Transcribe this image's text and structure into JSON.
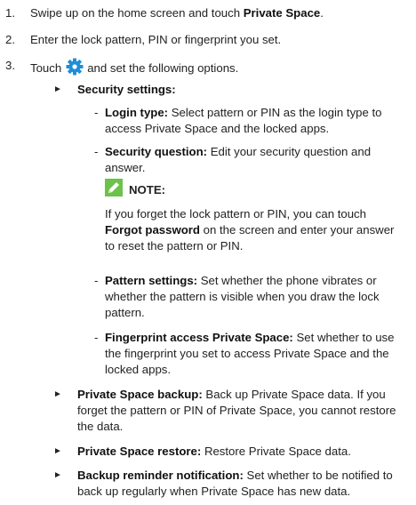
{
  "steps": [
    {
      "num": "1.",
      "pre": "Swipe up on the home screen and touch ",
      "bold": "Private Space",
      "post": "."
    },
    {
      "num": "2.",
      "text": "Enter the lock pattern, PIN or fingerprint you set."
    },
    {
      "num": "3.",
      "pre": "Touch",
      "post": "and set the following options.",
      "icon": "gear-icon"
    }
  ],
  "bullet_marker": "►",
  "dash": "-",
  "security_settings": {
    "label": "Security settings:"
  },
  "login_type": {
    "label": "Login type:",
    "text": " Select pattern or PIN as the login type to access Private Space and the locked apps."
  },
  "security_question": {
    "label": "Security question:",
    "text": " Edit your security question and answer."
  },
  "note": {
    "title": "NOTE:",
    "pre": "If you forget the lock pattern or PIN, you can touch ",
    "bold": "Forgot password",
    "post": " on the screen and enter your answer to reset the pattern or PIN.",
    "icon": "pencil-icon"
  },
  "pattern_settings": {
    "label": "Pattern settings:",
    "text": " Set whether the phone vibrates or whether the pattern is visible when you draw the lock pattern."
  },
  "fingerprint_access": {
    "label": "Fingerprint access Private Space:",
    "text": " Set whether to use the fingerprint you set to access Private Space and the locked apps."
  },
  "backup": {
    "label": "Private Space backup:",
    "text": " Back up Private Space data. If you forget the pattern or PIN of Private Space, you cannot restore the data."
  },
  "restore": {
    "label": "Private Space restore:",
    "text": " Restore Private Space data."
  },
  "reminder": {
    "label": "Backup reminder notification:",
    "text": " Set whether to be notified to back up regularly when Private Space has new data."
  },
  "colors": {
    "gear": "#1f8fd6",
    "pencil": "#6cc24a"
  }
}
